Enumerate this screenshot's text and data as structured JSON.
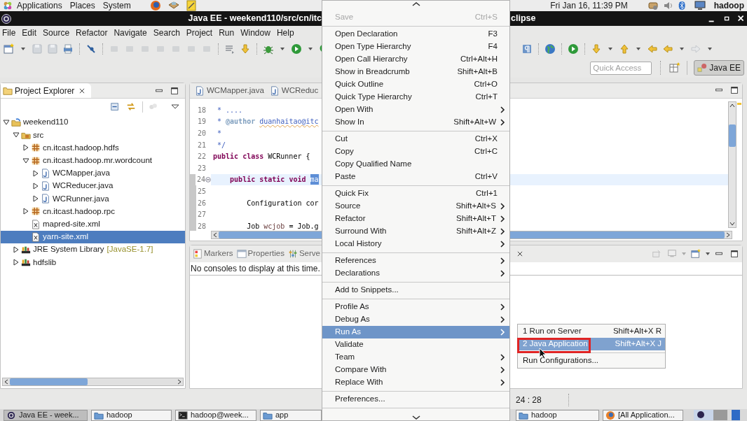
{
  "top_panel": {
    "menus": [
      "Applications",
      "Places",
      "System"
    ],
    "clock": "Fri Jan 16, 11:39 PM",
    "user": "hadoop"
  },
  "window": {
    "title_left": "Java EE - weekend110/src/cn/itc",
    "title_right": "clipse"
  },
  "menu_bar": [
    "File",
    "Edit",
    "Source",
    "Refactor",
    "Navigate",
    "Search",
    "Project",
    "Run",
    "Window",
    "Help"
  ],
  "quick_access": {
    "placeholder": "Quick Access"
  },
  "perspective": {
    "label": "Java EE",
    "selected": true
  },
  "project_explorer": {
    "title": "Project Explorer",
    "tree": [
      {
        "label": "weekend110",
        "kind": "project",
        "expanded": true,
        "selected": false,
        "children": [
          {
            "label": "src",
            "kind": "source-folder",
            "expanded": true,
            "selected": false,
            "children": [
              {
                "label": "cn.itcast.hadoop.hdfs",
                "kind": "package",
                "expanded": false,
                "selected": false
              },
              {
                "label": "cn.itcast.hadoop.mr.wordcount",
                "kind": "package",
                "expanded": true,
                "selected": false,
                "children": [
                  {
                    "label": "WCMapper.java",
                    "kind": "java",
                    "expanded": false,
                    "selected": false
                  },
                  {
                    "label": "WCReducer.java",
                    "kind": "java",
                    "expanded": false,
                    "selected": false
                  },
                  {
                    "label": "WCRunner.java",
                    "kind": "java",
                    "expanded": false,
                    "selected": false
                  }
                ]
              },
              {
                "label": "cn.itcast.hadoop.rpc",
                "kind": "package",
                "expanded": false,
                "selected": false
              },
              {
                "label": "mapred-site.xml",
                "kind": "xml",
                "selected": false
              },
              {
                "label": "yarn-site.xml",
                "kind": "xml",
                "selected": true
              }
            ]
          },
          {
            "label": "JRE System Library",
            "decoration": "[JavaSE-1.7]",
            "kind": "library",
            "expanded": false,
            "selected": false
          },
          {
            "label": "hdfslib",
            "kind": "library",
            "expanded": false,
            "selected": false
          }
        ]
      }
    ]
  },
  "editor": {
    "tabs": [
      {
        "label": "WCMapper.java",
        "selected": false
      },
      {
        "label": "WCReduc",
        "selected": false
      }
    ],
    "lines": [
      {
        "number": "18",
        "current": false,
        "changed": false,
        "fold": false,
        "tokens": [
          {
            "text": " * ....",
            "kind": "comment"
          }
        ]
      },
      {
        "number": "19",
        "current": false,
        "changed": false,
        "fold": false,
        "tokens": [
          {
            "text": " * ",
            "kind": "comment"
          },
          {
            "text": "@author ",
            "kind": "tag"
          },
          {
            "text": "duanhaitao@itc",
            "kind": "link"
          }
        ]
      },
      {
        "number": "20",
        "current": false,
        "changed": false,
        "fold": false,
        "tokens": [
          {
            "text": " *",
            "kind": "comment"
          }
        ]
      },
      {
        "number": "21",
        "current": false,
        "changed": false,
        "fold": false,
        "tokens": [
          {
            "text": " */",
            "kind": "comment"
          }
        ]
      },
      {
        "number": "22",
        "current": false,
        "changed": false,
        "fold": false,
        "tokens": [
          {
            "text": "public",
            "kind": "keyword"
          },
          {
            "text": " class",
            "kind": "keyword"
          },
          {
            "text": " WCRunner {",
            "kind": "plain"
          }
        ]
      },
      {
        "number": "23",
        "current": false,
        "changed": false,
        "fold": false
      },
      {
        "number": "24",
        "current": true,
        "changed": true,
        "fold": true,
        "tokens": [
          {
            "text": "    public",
            "kind": "keyword"
          },
          {
            "text": " static",
            "kind": "keyword"
          },
          {
            "text": " void ",
            "kind": "keyword"
          },
          {
            "text": "ma",
            "kind": "selection"
          }
        ]
      },
      {
        "number": "25",
        "current": false,
        "changed": true,
        "fold": false
      },
      {
        "number": "26",
        "current": false,
        "changed": true,
        "fold": false,
        "tokens": [
          {
            "text": "        Configuration ",
            "kind": "plain"
          },
          {
            "text": "cor",
            "kind": "plain"
          }
        ]
      },
      {
        "number": "27",
        "current": false,
        "changed": true,
        "fold": false
      },
      {
        "number": "28",
        "current": false,
        "changed": true,
        "fold": false,
        "tokens": [
          {
            "text": "        Job ",
            "kind": "plain"
          },
          {
            "text": "wcjob",
            "kind": "local"
          },
          {
            "text": " = Job.g",
            "kind": "plain"
          }
        ]
      }
    ]
  },
  "bottom_panel": {
    "tabs": [
      {
        "label": "Markers",
        "kind": "markers"
      },
      {
        "label": "Properties",
        "kind": "properties"
      },
      {
        "label": "Serve",
        "kind": "servers"
      }
    ],
    "message": "No consoles to display at this time."
  },
  "status_bar": {
    "position": "24 : 28"
  },
  "taskbar": {
    "left": [
      {
        "label": "Java EE - week...",
        "kind": "app",
        "selected": true
      },
      {
        "label": "hadoop",
        "kind": "folder",
        "selected": false
      },
      {
        "label": "hadoop@week...",
        "kind": "terminal",
        "selected": false
      },
      {
        "label": "app",
        "kind": "folder",
        "selected": false
      }
    ],
    "right": [
      {
        "label": "hadoop",
        "kind": "folder",
        "selected": false
      },
      {
        "label": "[All Application...",
        "kind": "browser",
        "selected": false
      }
    ]
  },
  "context_menu": {
    "items": [
      {
        "kind": "item",
        "label": "Save",
        "shortcut": "Ctrl+S",
        "submenu": false,
        "disabled": true,
        "selected": false
      },
      {
        "kind": "separator"
      },
      {
        "kind": "item",
        "label": "Open Declaration",
        "shortcut": "F3",
        "submenu": false,
        "disabled": false,
        "selected": false
      },
      {
        "kind": "item",
        "label": "Open Type Hierarchy",
        "shortcut": "F4",
        "submenu": false,
        "disabled": false,
        "selected": false
      },
      {
        "kind": "item",
        "label": "Open Call Hierarchy",
        "shortcut": "Ctrl+Alt+H",
        "submenu": false,
        "disabled": false,
        "selected": false
      },
      {
        "kind": "item",
        "label": "Show in Breadcrumb",
        "shortcut": "Shift+Alt+B",
        "submenu": false,
        "disabled": false,
        "selected": false
      },
      {
        "kind": "item",
        "label": "Quick Outline",
        "shortcut": "Ctrl+O",
        "submenu": false,
        "disabled": false,
        "selected": false
      },
      {
        "kind": "item",
        "label": "Quick Type Hierarchy",
        "shortcut": "Ctrl+T",
        "submenu": false,
        "disabled": false,
        "selected": false
      },
      {
        "kind": "item",
        "label": "Open With",
        "submenu": true,
        "disabled": false,
        "selected": false
      },
      {
        "kind": "item",
        "label": "Show In",
        "shortcut": "Shift+Alt+W",
        "submenu": true,
        "disabled": false,
        "selected": false
      },
      {
        "kind": "separator"
      },
      {
        "kind": "item",
        "label": "Cut",
        "shortcut": "Ctrl+X",
        "submenu": false,
        "disabled": false,
        "selected": false
      },
      {
        "kind": "item",
        "label": "Copy",
        "shortcut": "Ctrl+C",
        "submenu": false,
        "disabled": false,
        "selected": false
      },
      {
        "kind": "item",
        "label": "Copy Qualified Name",
        "submenu": false,
        "disabled": false,
        "selected": false
      },
      {
        "kind": "item",
        "label": "Paste",
        "shortcut": "Ctrl+V",
        "submenu": false,
        "disabled": false,
        "selected": false
      },
      {
        "kind": "separator"
      },
      {
        "kind": "item",
        "label": "Quick Fix",
        "shortcut": "Ctrl+1",
        "submenu": false,
        "disabled": false,
        "selected": false
      },
      {
        "kind": "item",
        "label": "Source",
        "shortcut": "Shift+Alt+S",
        "submenu": true,
        "disabled": false,
        "selected": false
      },
      {
        "kind": "item",
        "label": "Refactor",
        "shortcut": "Shift+Alt+T",
        "submenu": true,
        "disabled": false,
        "selected": false
      },
      {
        "kind": "item",
        "label": "Surround With",
        "shortcut": "Shift+Alt+Z",
        "submenu": true,
        "disabled": false,
        "selected": false
      },
      {
        "kind": "item",
        "label": "Local History",
        "submenu": true,
        "disabled": false,
        "selected": false
      },
      {
        "kind": "separator"
      },
      {
        "kind": "item",
        "label": "References",
        "submenu": true,
        "disabled": false,
        "selected": false
      },
      {
        "kind": "item",
        "label": "Declarations",
        "submenu": true,
        "disabled": false,
        "selected": false
      },
      {
        "kind": "separator"
      },
      {
        "kind": "item",
        "label": "Add to Snippets...",
        "submenu": false,
        "disabled": false,
        "selected": false
      },
      {
        "kind": "separator"
      },
      {
        "kind": "item",
        "label": "Profile As",
        "submenu": true,
        "disabled": false,
        "selected": false
      },
      {
        "kind": "item",
        "label": "Debug As",
        "submenu": true,
        "disabled": false,
        "selected": false
      },
      {
        "kind": "item",
        "label": "Run As",
        "submenu": true,
        "disabled": false,
        "selected": true
      },
      {
        "kind": "item",
        "label": "Validate",
        "submenu": false,
        "disabled": false,
        "selected": false
      },
      {
        "kind": "item",
        "label": "Team",
        "submenu": true,
        "disabled": false,
        "selected": false
      },
      {
        "kind": "item",
        "label": "Compare With",
        "submenu": true,
        "disabled": false,
        "selected": false
      },
      {
        "kind": "item",
        "label": "Replace With",
        "submenu": true,
        "disabled": false,
        "selected": false
      },
      {
        "kind": "separator"
      },
      {
        "kind": "item",
        "label": "Preferences...",
        "submenu": false,
        "disabled": false,
        "selected": false
      },
      {
        "kind": "separator"
      }
    ]
  },
  "submenu": {
    "items": [
      {
        "kind": "item",
        "label": "1 Run on Server",
        "shortcut": "Shift+Alt+X R",
        "selected": false
      },
      {
        "kind": "item",
        "label": "2 Java Application",
        "shortcut": "Shift+Alt+X J",
        "selected": true
      },
      {
        "kind": "separator"
      },
      {
        "kind": "item",
        "label": "Run Configurations...",
        "selected": false
      }
    ]
  }
}
